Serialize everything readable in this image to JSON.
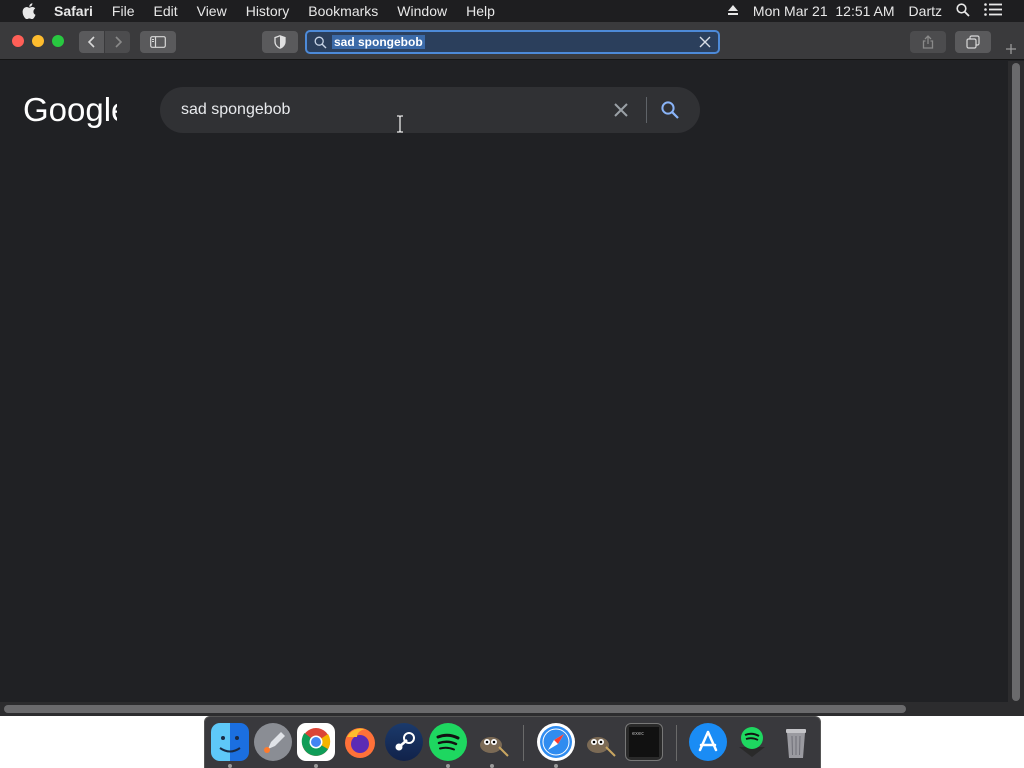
{
  "menubar": {
    "app_name": "Safari",
    "items": [
      "File",
      "Edit",
      "View",
      "History",
      "Bookmarks",
      "Window",
      "Help"
    ],
    "datetime": "Mon Mar 21  12:51 AM",
    "user": "Dartz"
  },
  "toolbar": {
    "address_text": "sad spongebob"
  },
  "page": {
    "logo": "Google",
    "search_query": "sad spongebob"
  },
  "dock": {
    "apps": [
      "Finder",
      "Launchpad",
      "Google Chrome",
      "Firefox",
      "Steam",
      "Spotify",
      "GIMP",
      "Safari",
      "GIMP",
      "Terminal",
      "App Store",
      "Spotify",
      "Trash"
    ]
  },
  "colors": {
    "page_bg": "#202124",
    "searchbox_bg": "#303134",
    "address_focus": "#4d8ad8",
    "search_icon": "#8ab4f8"
  }
}
